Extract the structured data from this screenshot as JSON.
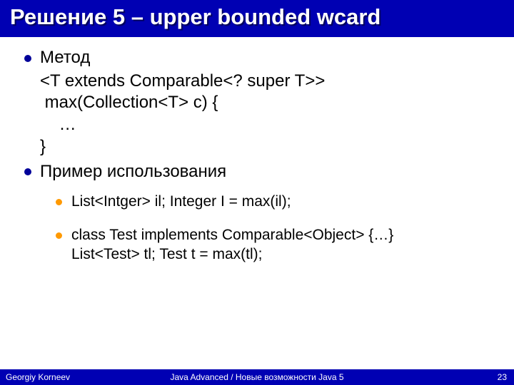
{
  "title": "Решение 5 – upper bounded wcard",
  "bullets": {
    "method_label": "Метод",
    "code": {
      "l1": "<T extends Comparable<? super T>>",
      "l2": " max(Collection<T> c) {",
      "l3": "    …",
      "l4": "}"
    },
    "example_label": "Пример использования",
    "sub": {
      "a": "List<Intger> il; Integer I = max(il);",
      "b1": "class Test implements Comparable<Object> {…}",
      "b2": "List<Test> tl; Test t = max(tl);"
    }
  },
  "footer": {
    "left": "Georgiy Korneev",
    "center": "Java Advanced / Новые возможности Java 5",
    "right": "23"
  }
}
